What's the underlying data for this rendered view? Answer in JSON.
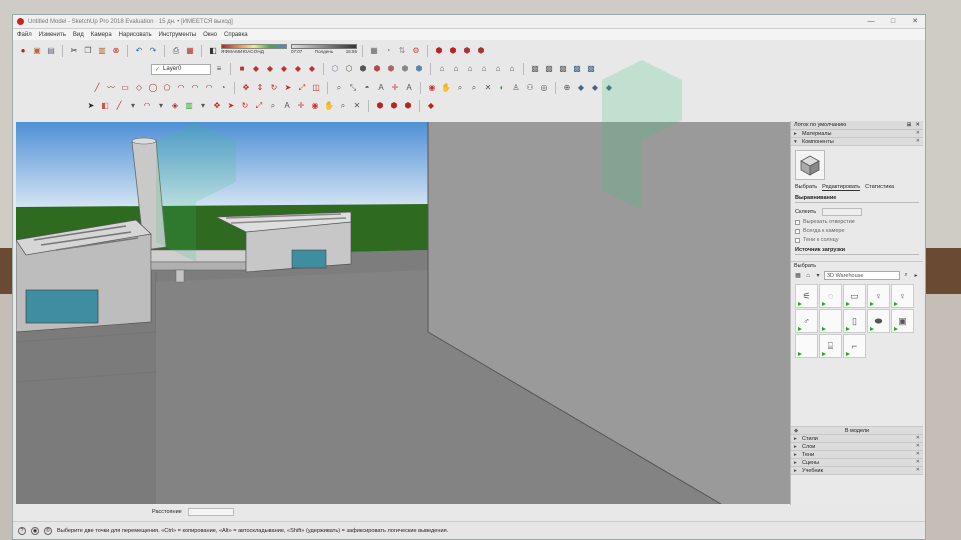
{
  "window": {
    "title": "Untitled Model - SketchUp Pro 2018 Evaluation · 15 дн. • [ИМЕЕТСЯ выход]",
    "controls": [
      "—",
      "□",
      "✕"
    ]
  },
  "menu": [
    "Файл",
    "Изменить",
    "Вид",
    "Камера",
    "Нарисовать",
    "Инструменты",
    "Окно",
    "Справка"
  ],
  "toolbar": {
    "layer_value": "Layer0",
    "shadow_letters": "ЯФМАМИЮАСОНД",
    "fog_start": "07:07",
    "fog_mid": "Полдень",
    "fog_end": "16:55"
  },
  "tray": {
    "title": "Лоток по умолчанию",
    "sections": {
      "materials": "Материалы",
      "components": "Компоненты"
    },
    "comp_tabs": [
      "Выбрать",
      "Редактировать",
      "Статистика"
    ],
    "align_heading": "Выравнивание",
    "glue_label": "Склеить",
    "options": [
      "Вырезать отверстие",
      "Всегда к камере",
      "Тени к солнцу"
    ],
    "load_source": "Источник загрузки",
    "select_heading": "Выбрать",
    "search_placeholder": "3D Warehouse",
    "incut_label": "В модели",
    "collapsed": [
      "Стили",
      "Слои",
      "Тени",
      "Сцены",
      "Учебник"
    ]
  },
  "vcb": {
    "label": "Расстояние"
  },
  "status": {
    "message": "Выберите две точки для перемещения. «Ctrl» = копирование, «Alt» = автоскладывание, «Shift» (удерживать) = зафиксировать логические выведения."
  },
  "colors": {
    "sky_top": "#4f8fd6",
    "sky_bottom": "#cfe0f2",
    "grass": "#2e6a1f",
    "ground": "#7b7b7b",
    "watermark": "#36c27a"
  }
}
